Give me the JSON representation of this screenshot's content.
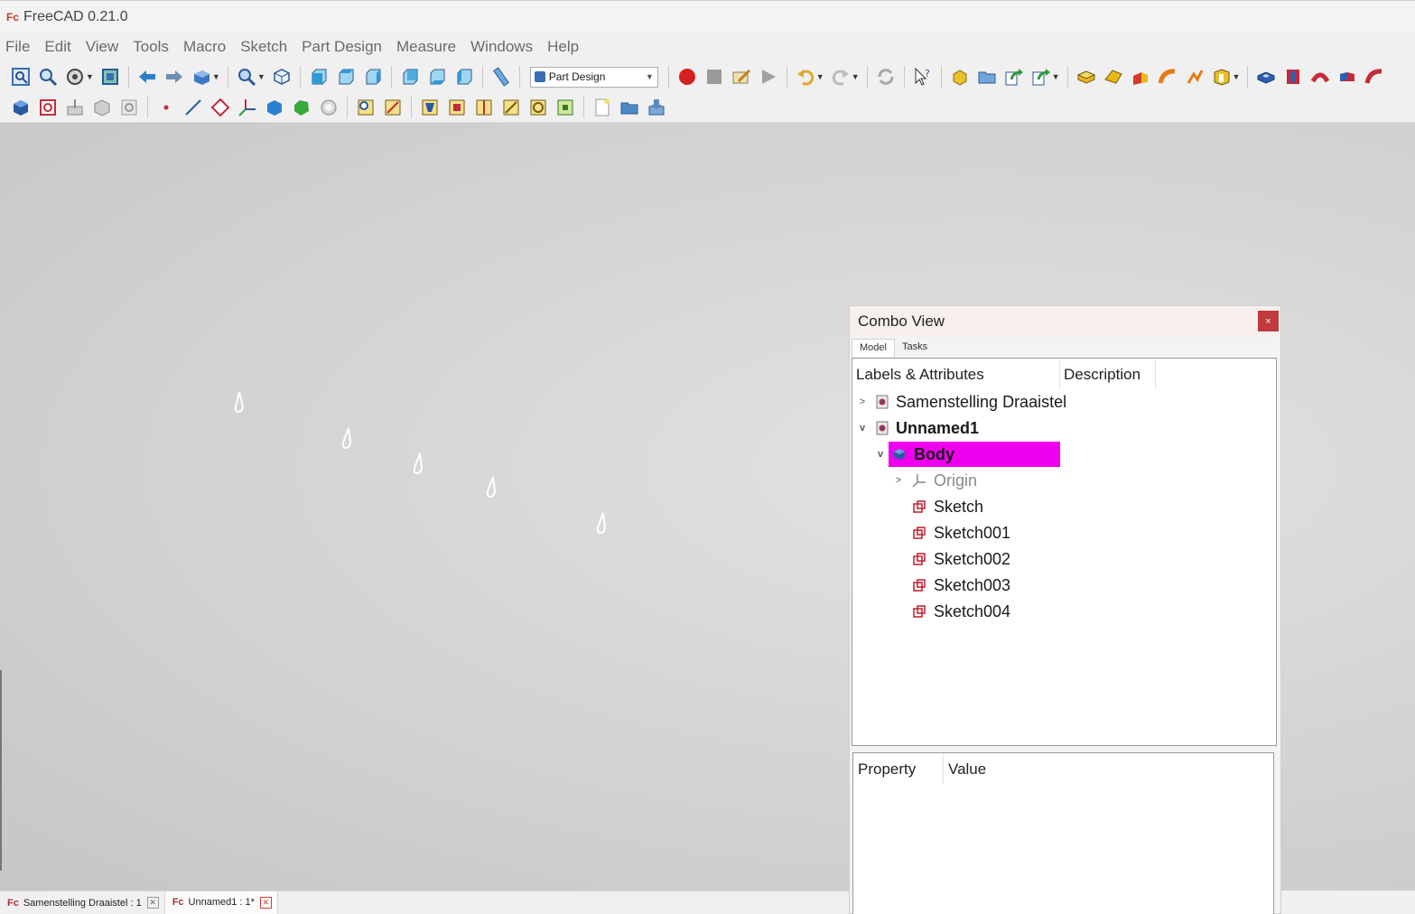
{
  "window": {
    "title": "FreeCAD 0.21.0"
  },
  "menu": [
    "File",
    "Edit",
    "View",
    "Tools",
    "Macro",
    "Sketch",
    "Part Design",
    "Measure",
    "Windows",
    "Help"
  ],
  "workbench_selector": {
    "selected": "Part Design"
  },
  "combo_view": {
    "title": "Combo View",
    "close": "×",
    "tabs": [
      "Model",
      "Tasks"
    ],
    "tree_columns": [
      "Labels & Attributes",
      "Description"
    ],
    "tree": [
      {
        "label": "Samenstelling Draaistel",
        "expanded": false
      },
      {
        "label": "Unnamed1",
        "expanded": true
      },
      {
        "label": "Body",
        "expanded": true,
        "selected": true
      },
      {
        "label": "Origin",
        "expanded": false
      },
      {
        "label": "Sketch"
      },
      {
        "label": "Sketch001"
      },
      {
        "label": "Sketch002"
      },
      {
        "label": "Sketch003"
      },
      {
        "label": "Sketch004"
      }
    ],
    "property_columns": [
      "Property",
      "Value"
    ]
  },
  "document_tabs": [
    {
      "label": "Samenstelling Draaistel : 1"
    },
    {
      "label": "Unnamed1 : 1*"
    }
  ],
  "colors": {
    "selection": "#ee00ee",
    "record": "#d42020",
    "close_button": "#c0393b"
  }
}
